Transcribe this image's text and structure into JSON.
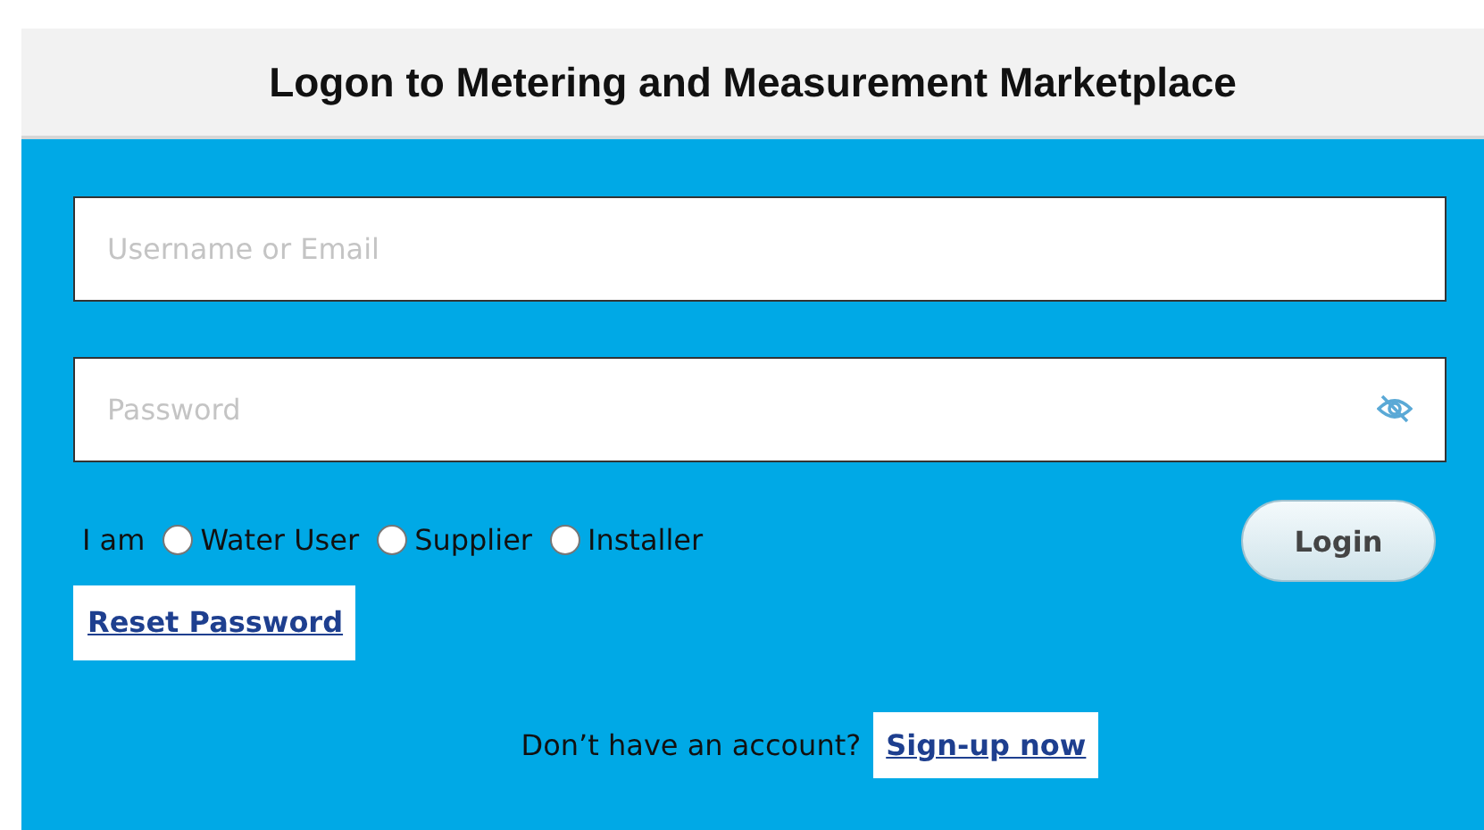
{
  "title": "Logon to Metering and Measurement Marketplace",
  "username": {
    "placeholder": "Username or Email"
  },
  "password": {
    "placeholder": "Password"
  },
  "role": {
    "label": "I am",
    "options": [
      {
        "label": "Water User",
        "selected": false
      },
      {
        "label": "Supplier",
        "selected": false
      },
      {
        "label": "Installer",
        "selected": false
      }
    ]
  },
  "login_button": "Login",
  "reset_link": "Reset Password",
  "signup": {
    "prompt": "Don’t have an account?",
    "link": "Sign-up now"
  }
}
